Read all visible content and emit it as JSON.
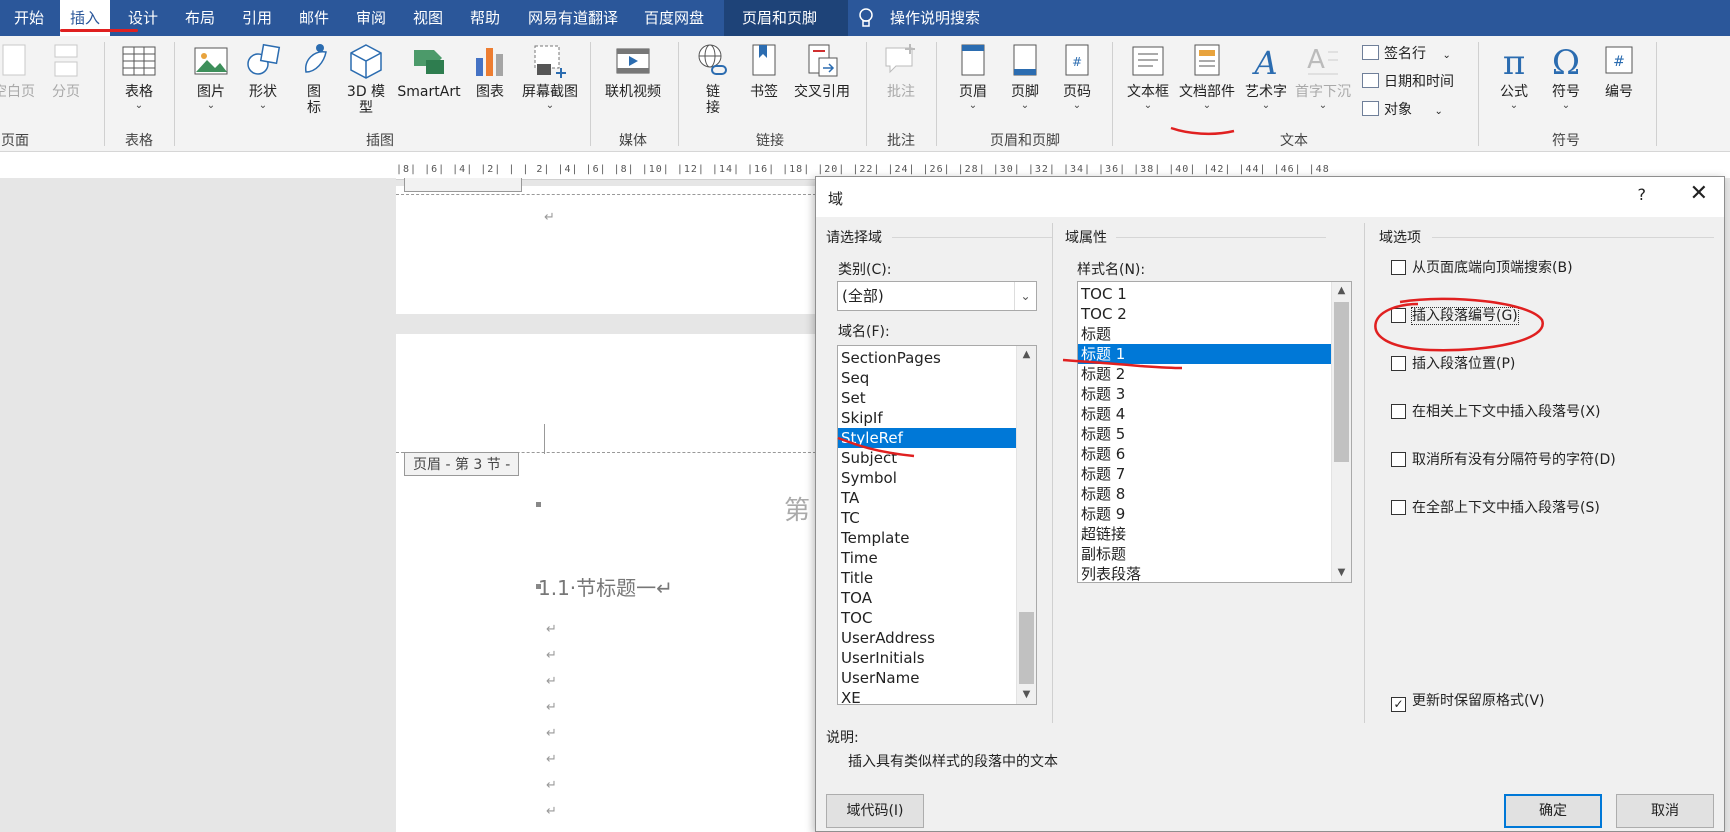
{
  "tabs": [
    {
      "label": "开始"
    },
    {
      "label": "插入"
    },
    {
      "label": "设计"
    },
    {
      "label": "布局"
    },
    {
      "label": "引用"
    },
    {
      "label": "邮件"
    },
    {
      "label": "审阅"
    },
    {
      "label": "视图"
    },
    {
      "label": "帮助"
    },
    {
      "label": "网易有道翻译"
    },
    {
      "label": "百度网盘"
    },
    {
      "label": "页眉和页脚"
    }
  ],
  "tell_me": "操作说明搜索",
  "ribbon": {
    "pages": {
      "blank": "空白页",
      "break": "分页",
      "group": "页面"
    },
    "tables": {
      "table": "表格",
      "group": "表格"
    },
    "illustrations": {
      "picture": "图片",
      "shapes": "形状",
      "icons": "图\n标",
      "model3d": "3D 模\n型",
      "smartart": "SmartArt",
      "chart": "图表",
      "screenshot": "屏幕截图",
      "group": "插图"
    },
    "media": {
      "video": "联机视频",
      "group": "媒体"
    },
    "links": {
      "link": "链\n接",
      "bookmark": "书签",
      "crossref": "交叉引用",
      "group": "链接"
    },
    "comments": {
      "comment": "批注",
      "group": "批注"
    },
    "header_footer": {
      "header": "页眉",
      "footer": "页脚",
      "pagenum": "页码",
      "group": "页眉和页脚"
    },
    "text": {
      "textbox": "文本框",
      "quickparts": "文档部件",
      "wordart": "艺术字",
      "dropcap": "首字下沉",
      "signature": "签名行",
      "datetime": "日期和时间",
      "object": "对象",
      "group": "文本"
    },
    "symbols": {
      "equation": "公式",
      "symbol": "符号",
      "number": "编号",
      "group": "符号"
    }
  },
  "ruler_text": "|8| |6| |4| |2| |  | 2| |4| |6| |8| |10| |12| |14| |16| |18| |20| |22| |24| |26| |28| |30| |32| |34| |36| |38| |40| |42| |44| |46| |48",
  "document": {
    "header_label": "页眉 - 第 3 节 -",
    "chapter_heading": "第",
    "section_heading": "1.1·节标题一↵",
    "para_mark": "↵"
  },
  "dialog": {
    "title": "域",
    "help": "?",
    "close": "✕",
    "choose_field": "请选择域",
    "category_label": "类别(C):",
    "category_value": "(全部)",
    "fieldname_label": "域名(F):",
    "field_names": [
      "SectionPages",
      "Seq",
      "Set",
      "SkipIf",
      "StyleRef",
      "Subject",
      "Symbol",
      "TA",
      "TC",
      "Template",
      "Time",
      "Title",
      "TOA",
      "TOC",
      "UserAddress",
      "UserInitials",
      "UserName",
      "XE"
    ],
    "field_selected_index": 4,
    "field_properties": "域属性",
    "stylename_label": "样式名(N):",
    "style_names": [
      "TOC 1",
      "TOC 2",
      "标题",
      "标题 1",
      "标题 2",
      "标题 3",
      "标题 4",
      "标题 5",
      "标题 6",
      "标题 7",
      "标题 8",
      "标题 9",
      "超链接",
      "副标题",
      "列表段落"
    ],
    "style_selected_index": 3,
    "field_options": "域选项",
    "options": [
      {
        "label": "从页面底端向顶端搜索(B)",
        "checked": false
      },
      {
        "label": "插入段落编号(G)",
        "checked": false
      },
      {
        "label": "插入段落位置(P)",
        "checked": false
      },
      {
        "label": "在相关上下文中插入段落号(X)",
        "checked": false
      },
      {
        "label": "取消所有没有分隔符号的字符(D)",
        "checked": false
      },
      {
        "label": "在全部上下文中插入段落号(S)",
        "checked": false
      }
    ],
    "preserve_format": {
      "label": "更新时保留原格式(V)",
      "checked": true
    },
    "desc_label": "说明:",
    "desc_text": "插入具有类似样式的段落中的文本",
    "field_codes_btn": "域代码(I)",
    "ok_btn": "确定",
    "cancel_btn": "取消"
  },
  "colors": {
    "tabbar": "#2b579a",
    "selection": "#0078d7",
    "annotation": "#e02020"
  }
}
